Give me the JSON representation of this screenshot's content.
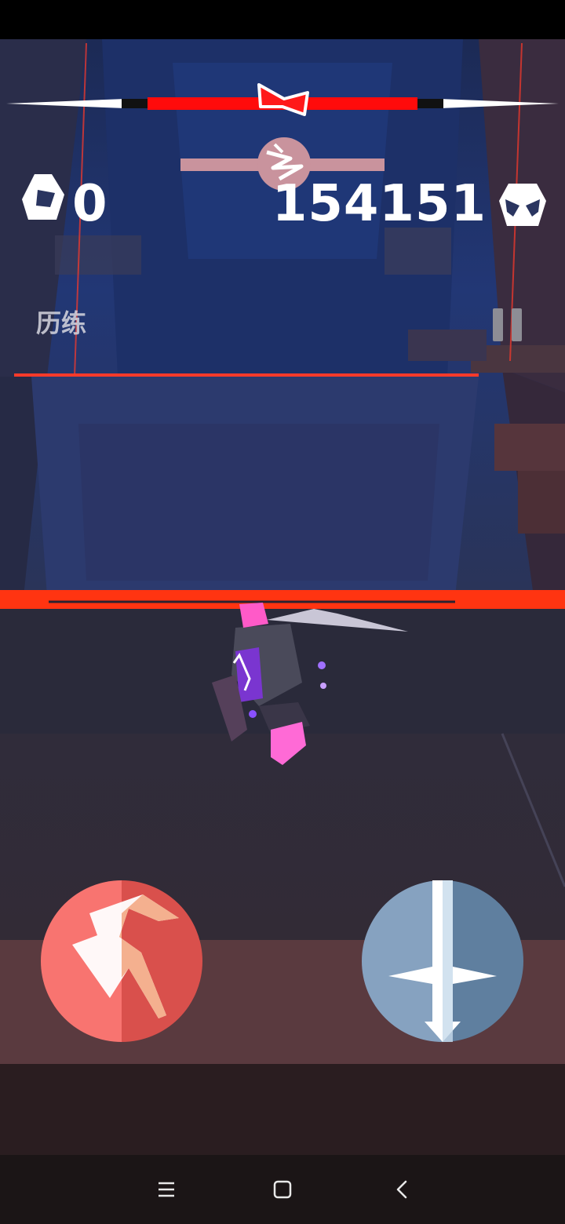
{
  "hud": {
    "gem_count": "0",
    "score": "154151",
    "mode_label": "历练"
  },
  "boss_health": {
    "fill_fraction": 1.0
  },
  "skill_energy": {
    "fill_fraction": 1.0
  },
  "controls": {
    "left_button": "dash-button",
    "right_button": "sword-attack-button"
  },
  "navbar": {
    "items": [
      "menu",
      "home",
      "back"
    ]
  },
  "colors": {
    "health_red": "#ff0b0b",
    "energy_pink": "#c9939d",
    "dash_button": "#f26a66",
    "attack_button": "#7d98b6",
    "lava_line": "#ff3411",
    "background_blue": "#1f2f5f"
  }
}
